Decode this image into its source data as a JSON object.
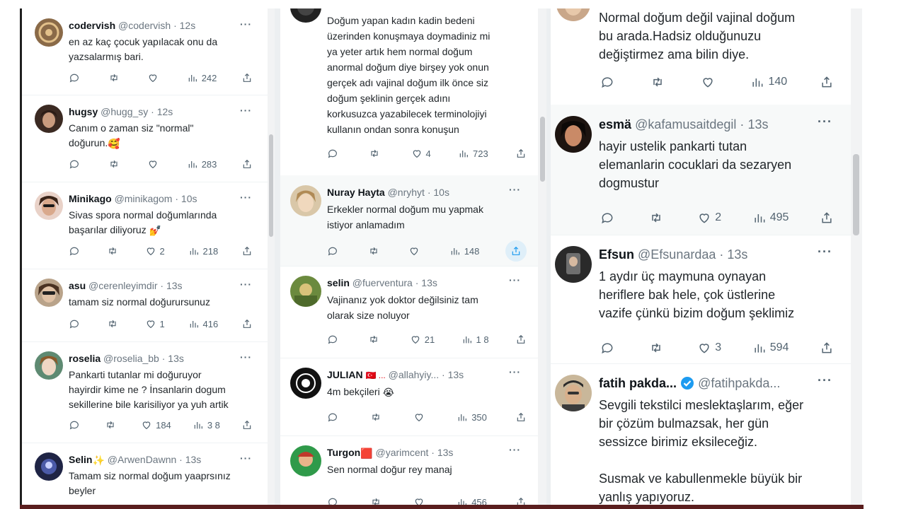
{
  "colors": {
    "text": "#0f1419",
    "muted": "#536471",
    "verified": "#1d9bf0",
    "highlight": "#f7f9f9"
  },
  "col1": {
    "tweets": [
      {
        "name": "codervish",
        "handle": "@codervish",
        "time": "12s",
        "text": "en az kaç çocuk yapılacak onu da\nyazsalarmış bari.",
        "replies": "",
        "retweets": "",
        "likes": "",
        "views": "242"
      },
      {
        "name": "hugsy",
        "handle": "@hugg_sy",
        "time": "12s",
        "text": "Canım o zaman siz \"normal\"\ndoğurun.",
        "emoji": "🥰",
        "replies": "",
        "retweets": "",
        "likes": "",
        "views": "283"
      },
      {
        "name": "Minikago",
        "handle": "@minikagom",
        "time": "10s",
        "text": "Sivas spora normal doğumlarında\nbaşarılar diliyoruz",
        "emoji": "💅",
        "replies": "",
        "retweets": "",
        "likes": "2",
        "views": "218"
      },
      {
        "name": "asu",
        "handle": "@cerenleyimdir",
        "time": "13s",
        "text": "tamam siz normal doğurursunuz",
        "replies": "",
        "retweets": "",
        "likes": "1",
        "views": "416"
      },
      {
        "name": "roselia",
        "handle": "@roselia_bb",
        "time": "13s",
        "text": "Pankarti tutanlar mi doğuruyor\nhayirdir kime ne ? İnsanlarin dogum\nsekillerine bile karisiliyor ya yuh artik",
        "replies": "",
        "retweets": "",
        "likes": "184",
        "views": "3 8"
      },
      {
        "name": "Selin",
        "name_emoji": "✨",
        "handle": "@ArwenDawnn",
        "time": "13s",
        "text": "Tamam siz normal doğum yaaprsınız\nbeyler"
      }
    ]
  },
  "col2": {
    "tweets": [
      {
        "name": "",
        "handle": "",
        "time": "",
        "text": "Doğum yapan kadın kadin bedeni\nüzerinden konuşmaya doymadiniz mi\nya yeter artık hem normal doğum\nanormal doğum diye birşey yok onun\ngerçek adı vajinal doğum ilk önce siz\ndoğum şeklinin gerçek adını\nkorkusuzca yazabilecek terminolojiyi\nkullanın ondan sonra konuşun",
        "replies": "",
        "retweets": "",
        "likes": "4",
        "views": "723"
      },
      {
        "name": "Nuray Hayta",
        "handle": "@nryhyt",
        "time": "10s",
        "text": "Erkekler normal doğum mu yapmak\nistiyor anlamadım",
        "replies": "",
        "retweets": "",
        "likes": "",
        "views": "148"
      },
      {
        "name": "selin",
        "handle": "@fuerventura",
        "time": "13s",
        "text": "Vajinanız yok doktor değilsiniz tam\nolarak size noluyor",
        "replies": "",
        "retweets": "",
        "likes": "21",
        "views": "1 8"
      },
      {
        "name": "JULIAN",
        "name_emoji": "🇹🇷 ...",
        "handle": "@allahyiy...",
        "time": "13s",
        "text": "4m bekçileri",
        "emoji": "😭",
        "replies": "",
        "retweets": "",
        "likes": "",
        "views": "350"
      },
      {
        "name": "Turgon",
        "name_emoji": "🟥",
        "handle": "@yarimcent",
        "time": "13s",
        "text": "Sen normal doğur rey manaj",
        "replies": "",
        "retweets": "",
        "likes": "",
        "views": "456"
      }
    ]
  },
  "col3": {
    "tweets": [
      {
        "name": "",
        "handle": "",
        "time": "",
        "text": "Normal doğum değil vajinal doğum\nbu arada.Hadsiz olduğunuzu\ndeğiştirmez ama bilin diye.",
        "replies": "",
        "retweets": "",
        "likes": "",
        "views": "140"
      },
      {
        "name": "esmä",
        "handle": "@kafamusaitdegil",
        "time": "13s",
        "text": "hayir ustelik pankarti tutan\nelemanlarin cocuklari da sezaryen\ndogmustur",
        "replies": "",
        "retweets": "",
        "likes": "2",
        "views": "495"
      },
      {
        "name": "Efsun",
        "handle": "@Efsunardaa",
        "time": "13s",
        "text": "1 aydır üç maymuna oynayan\nheriflere bak hele, çok üstlerine\nvazife çünkü bizim doğum şeklimiz",
        "replies": "",
        "retweets": "",
        "likes": "3",
        "views": "594"
      },
      {
        "name": "fatih pakda...",
        "handle": "@fatihpakda...",
        "time": "",
        "text": "Sevgili tekstilci meslektaşlarım, eğer\nbir çözüm bulmazsak, her gün\nsessizce birimiz eksileceğiz.\n\nSusmak ve kabullenmekle büyük bir\nyanlış yapıyoruz.",
        "verified": true
      }
    ]
  }
}
